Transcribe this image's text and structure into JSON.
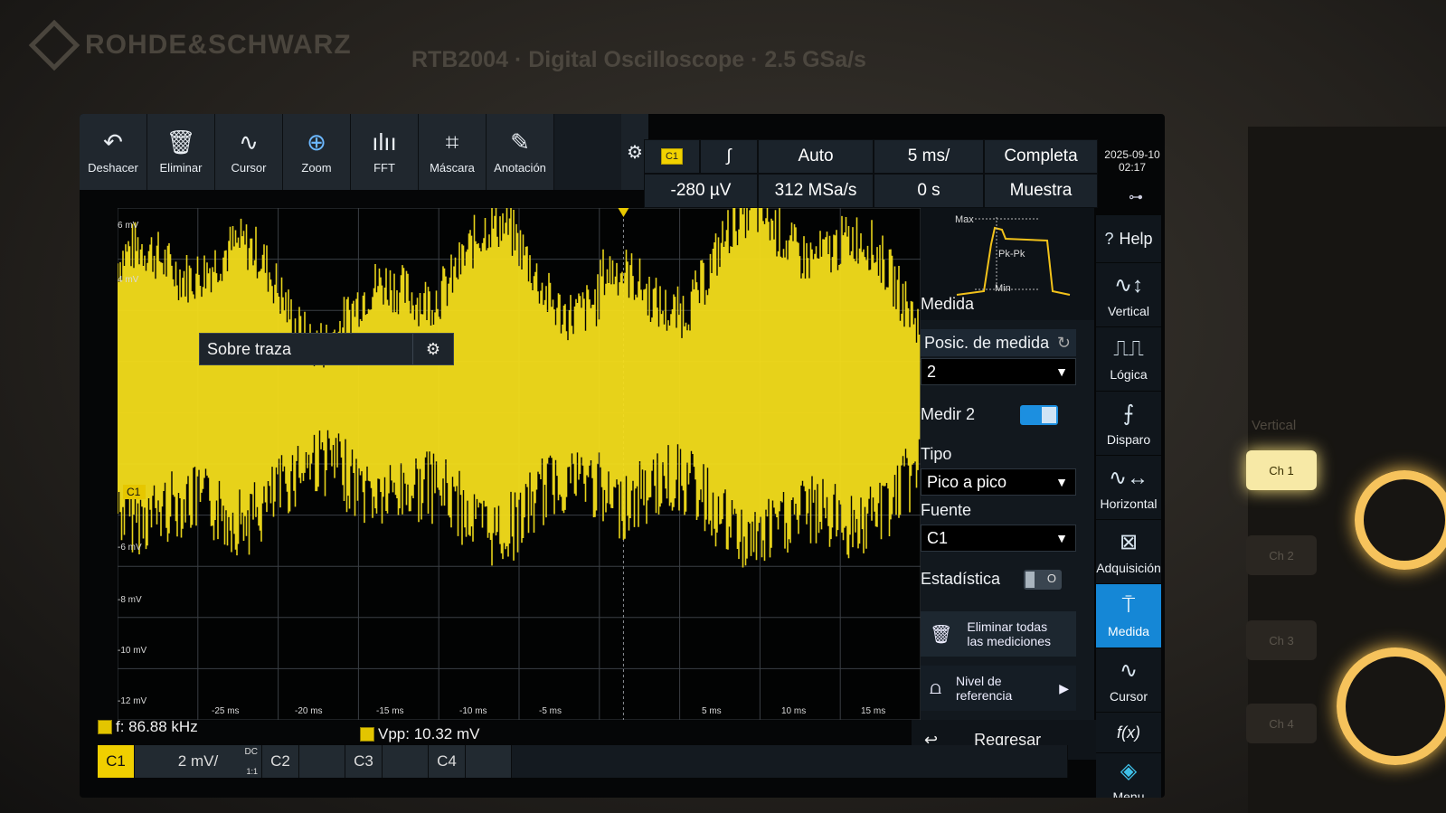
{
  "bezel": {
    "brand": "ROHDE&SCHWARZ",
    "model": "RTB2004 · Digital Oscilloscope · 2.5 GSa/s"
  },
  "toolbar": [
    {
      "label": "Deshacer",
      "icon": "undo-icon"
    },
    {
      "label": "Eliminar",
      "icon": "trash-icon"
    },
    {
      "label": "Cursor",
      "icon": "cursor-icon"
    },
    {
      "label": "Zoom",
      "icon": "zoom-icon"
    },
    {
      "label": "FFT",
      "icon": "fft-icon"
    },
    {
      "label": "Máscara",
      "icon": "mask-icon"
    },
    {
      "label": "Anotación",
      "icon": "pencil-icon"
    }
  ],
  "trigger_info": {
    "channel": "C1",
    "slope": "∫",
    "mode": "Auto",
    "timebase": "5 ms/",
    "acq_range": "Completa",
    "level": "-280 µV",
    "sample_rate": "312 MSa/s",
    "offset": "0 s",
    "acq_mode": "Muestra"
  },
  "datetime": {
    "date": "2025-09-10",
    "time": "02:17"
  },
  "plot": {
    "y_labels": [
      "6 mV",
      "4 mV",
      "-6 mV",
      "-8 mV",
      "-10 mV",
      "-12 mV"
    ],
    "x_labels": [
      "-25 ms",
      "-20 ms",
      "-15 ms",
      "-10 ms",
      "-5 ms",
      "5 ms",
      "10 ms",
      "15 ms"
    ],
    "channel_marker": "C1",
    "popup_label": "Sobre traza",
    "trace_color": "#f3dd1b"
  },
  "measure_panel": {
    "diagram": {
      "max": "Max",
      "pkpk": "Pk-Pk",
      "min": "Min"
    },
    "title": "Medida",
    "pos_label": "Posic. de medida",
    "pos_value": "2",
    "measure_label": "Medir 2",
    "measure_on": true,
    "type_label": "Tipo",
    "type_value": "Pico a pico",
    "source_label": "Fuente",
    "source_value": "C1",
    "stats_label": "Estadística",
    "stats_on": false,
    "delete_all": "Eliminar todas las mediciones",
    "ref_level": "Nivel de referencia",
    "back": "Regresar"
  },
  "right_menu": [
    {
      "label": "Help",
      "icon": "help-icon"
    },
    {
      "label": "Vertical",
      "icon": "vertical-icon"
    },
    {
      "label": "Lógica",
      "icon": "logic-icon"
    },
    {
      "label": "Disparo",
      "icon": "trigger-icon"
    },
    {
      "label": "Horizontal",
      "icon": "horizontal-icon"
    },
    {
      "label": "Adquisición",
      "icon": "acquisition-icon"
    },
    {
      "label": "Medida",
      "icon": "measure-icon",
      "active": true
    },
    {
      "label": "Cursor",
      "icon": "cursor-icon"
    },
    {
      "label": "f(x)",
      "icon": "math-icon"
    },
    {
      "label": "Menu",
      "icon": "rs-menu-icon"
    }
  ],
  "status": {
    "freq": "f: 86.88 kHz",
    "vpp": "Vpp: 10.32 mV"
  },
  "channels": {
    "c1": "C1",
    "c1_scale": "2 mV/",
    "c1_coupling": "DC",
    "c1_probe": "1:1",
    "c2": "C2",
    "c3": "C3",
    "c4": "C4"
  },
  "hardware": {
    "vertical_label": "Vertical",
    "ch1": "Ch 1",
    "ch2": "Ch 2",
    "ch3": "Ch 3",
    "ch4": "Ch 4"
  }
}
